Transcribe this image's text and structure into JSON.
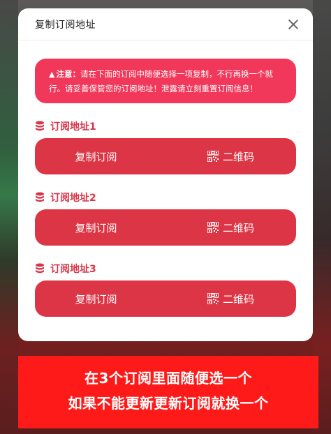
{
  "modal": {
    "title": "复制订阅地址",
    "notice": {
      "label": "注意：",
      "text": "请在下面的订阅中随便选择一项复制，不行再换一个就行。请妥善保管您的订阅地址！泄露请立刻重置订阅信息！"
    },
    "sections": [
      {
        "title": "订阅地址1",
        "copy_label": "复制订阅",
        "qr_label": "二维码"
      },
      {
        "title": "订阅地址2",
        "copy_label": "复制订阅",
        "qr_label": "二维码"
      },
      {
        "title": "订阅地址3",
        "copy_label": "复制订阅",
        "qr_label": "二维码"
      }
    ]
  },
  "banner": {
    "line1": "在3个订阅里面随便选一个",
    "line2": "如果不能更新更新订阅就换一个"
  },
  "colors": {
    "accent": "#dc3545",
    "notice_bg": "#f2385a",
    "banner_bg": "#ff1a1a"
  }
}
